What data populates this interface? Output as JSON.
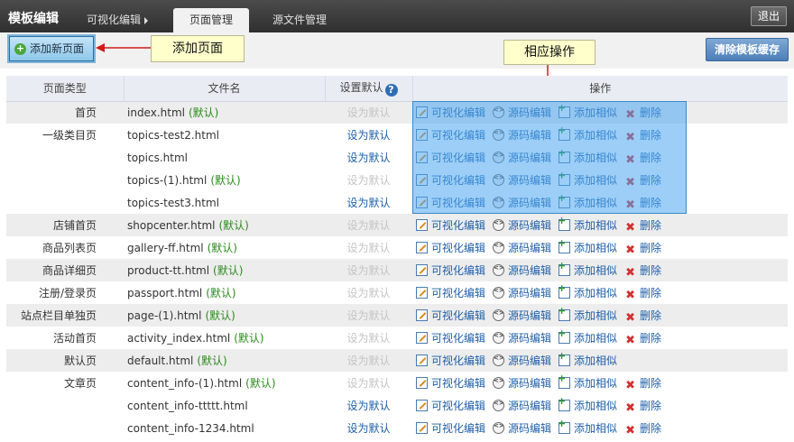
{
  "header": {
    "title": "模板编辑",
    "tabs": [
      {
        "label": "可视化编辑"
      },
      {
        "label": "页面管理"
      },
      {
        "label": "源文件管理"
      }
    ],
    "exit_label": "退出"
  },
  "toolbar": {
    "add_page_label": "添加新页面",
    "clear_cache_label": "清除模板缓存"
  },
  "annotations": {
    "add_note": "添加页面",
    "ops_note": "相应操作"
  },
  "table": {
    "columns": [
      "页面类型",
      "文件名",
      "设置默认",
      "操作"
    ],
    "default_tag": "(默认)",
    "set_default_label": "设为默认",
    "ops": {
      "visual_edit": "可视化编辑",
      "source_edit": "源码编辑",
      "add_similar": "添加相似",
      "delete": "删除"
    },
    "rows": [
      {
        "type": "首页",
        "file": "index.html",
        "is_default": true,
        "shaded": true,
        "deletable": true
      },
      {
        "type": "一级类目页",
        "file": "topics-test2.html",
        "is_default": false,
        "shaded": false,
        "deletable": true
      },
      {
        "type": "",
        "file": "topics.html",
        "is_default": false,
        "shaded": false,
        "deletable": true
      },
      {
        "type": "",
        "file": "topics-(1).html",
        "is_default": true,
        "shaded": false,
        "deletable": true
      },
      {
        "type": "",
        "file": "topics-test3.html",
        "is_default": false,
        "shaded": false,
        "deletable": true
      },
      {
        "type": "店铺首页",
        "file": "shopcenter.html",
        "is_default": true,
        "shaded": true,
        "deletable": true
      },
      {
        "type": "商品列表页",
        "file": "gallery-ff.html",
        "is_default": true,
        "shaded": false,
        "deletable": true
      },
      {
        "type": "商品详细页",
        "file": "product-tt.html",
        "is_default": true,
        "shaded": true,
        "deletable": true
      },
      {
        "type": "注册/登录页",
        "file": "passport.html",
        "is_default": true,
        "shaded": false,
        "deletable": true
      },
      {
        "type": "站点栏目单独页",
        "file": "page-(1).html",
        "is_default": true,
        "shaded": true,
        "deletable": true
      },
      {
        "type": "活动首页",
        "file": "activity_index.html",
        "is_default": true,
        "shaded": false,
        "deletable": true
      },
      {
        "type": "默认页",
        "file": "default.html",
        "is_default": true,
        "shaded": true,
        "deletable": false
      },
      {
        "type": "文章页",
        "file": "content_info-(1).html",
        "is_default": true,
        "shaded": false,
        "deletable": true
      },
      {
        "type": "",
        "file": "content_info-ttttt.html",
        "is_default": false,
        "shaded": false,
        "deletable": true
      },
      {
        "type": "",
        "file": "content_info-1234.html",
        "is_default": false,
        "shaded": false,
        "deletable": true
      }
    ]
  },
  "colors": {
    "default_tag": "#2a8a1a",
    "link": "#1f5fa8",
    "highlight": "#4ba5f0",
    "delete_icon": "#d23131"
  }
}
